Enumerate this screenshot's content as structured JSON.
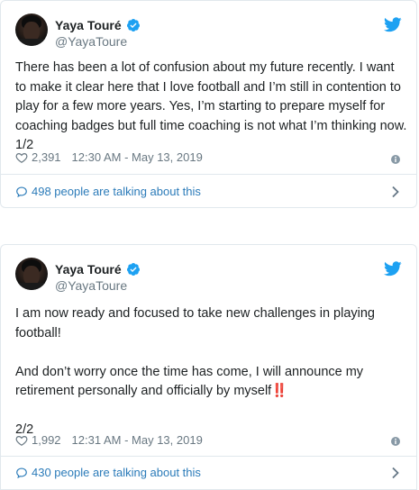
{
  "tweets": [
    {
      "name": "Yaya Touré",
      "handle": "@YayaToure",
      "text": "There has been a lot of confusion about my future recently. I want\nto make it clear here that I love football and I’m still in contention to\nplay for a few more years. Yes, I’m starting to prepare myself for\ncoaching badges but full time coaching is not what I’m thinking now.\n1/2",
      "likes": "2,391",
      "timestamp": "12:30 AM - May 13, 2019",
      "talking": "498 people are talking about this"
    },
    {
      "name": "Yaya Touré",
      "handle": "@YayaToure",
      "text": "I am now ready and focused to take new challenges in playing\nfootball!\n\nAnd don’t worry once the time has come, I will announce my\nretirement personally and officially by myself‼️\n\n2/2",
      "likes": "1,992",
      "timestamp": "12:31 AM - May 13, 2019",
      "talking": "430 people are talking about this"
    }
  ],
  "icons": {
    "verified": "verified-badge-icon",
    "bird": "twitter-bird-icon",
    "heart": "heart-icon",
    "info": "info-icon",
    "bubble": "comment-bubble-icon",
    "chevron": "chevron-right-icon"
  },
  "colors": {
    "twitter_blue": "#1da1f2",
    "link": "#2b7bb9",
    "muted": "#697882",
    "border": "#e1e8ed"
  }
}
